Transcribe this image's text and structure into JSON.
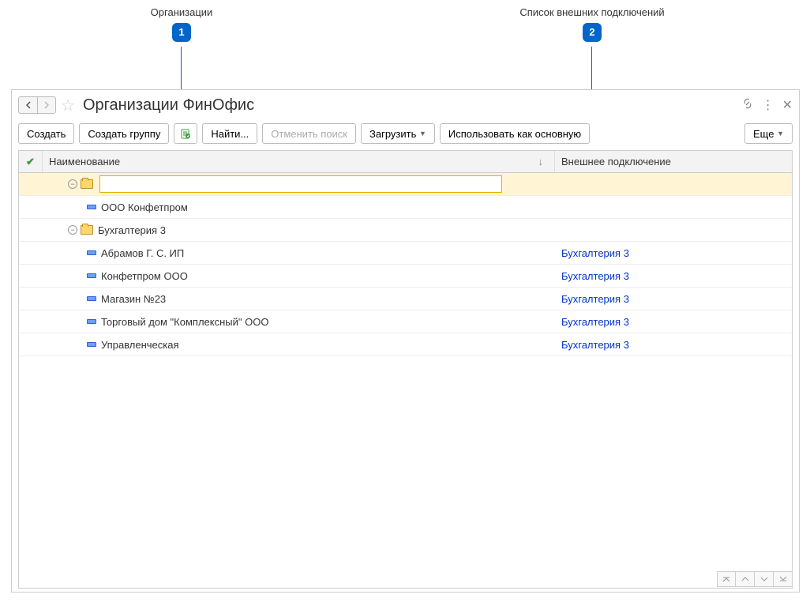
{
  "annotations": {
    "org": {
      "label": "Организации",
      "num": "1"
    },
    "conn": {
      "label": "Список внешних подключений",
      "num": "2"
    }
  },
  "window": {
    "title": "Организации ФинОфис"
  },
  "toolbar": {
    "create": "Создать",
    "create_group": "Создать группу",
    "find": "Найти...",
    "cancel_search": "Отменить поиск",
    "load": "Загрузить",
    "use_as_main": "Использовать как основную",
    "more": "Еще"
  },
  "table": {
    "col_check": "✔",
    "col_name": "Наименование",
    "col_conn": "Внешнее подключение",
    "rows": [
      {
        "type": "group-edit",
        "level": 1,
        "name": "",
        "conn": ""
      },
      {
        "type": "item",
        "level": 2,
        "name": "ООО Конфетпром",
        "conn": ""
      },
      {
        "type": "group",
        "level": 1,
        "name": "Бухгалтерия 3",
        "conn": ""
      },
      {
        "type": "item",
        "level": 2,
        "name": "Абрамов Г. С. ИП",
        "conn": "Бухгалтерия 3"
      },
      {
        "type": "item",
        "level": 2,
        "name": "Конфетпром ООО",
        "conn": "Бухгалтерия 3"
      },
      {
        "type": "item",
        "level": 2,
        "name": "Магазин №23",
        "conn": "Бухгалтерия 3"
      },
      {
        "type": "item",
        "level": 2,
        "name": "Торговый дом \"Комплексный\" ООО",
        "conn": "Бухгалтерия 3"
      },
      {
        "type": "item",
        "level": 2,
        "name": "Управленческая",
        "conn": "Бухгалтерия 3"
      }
    ]
  }
}
